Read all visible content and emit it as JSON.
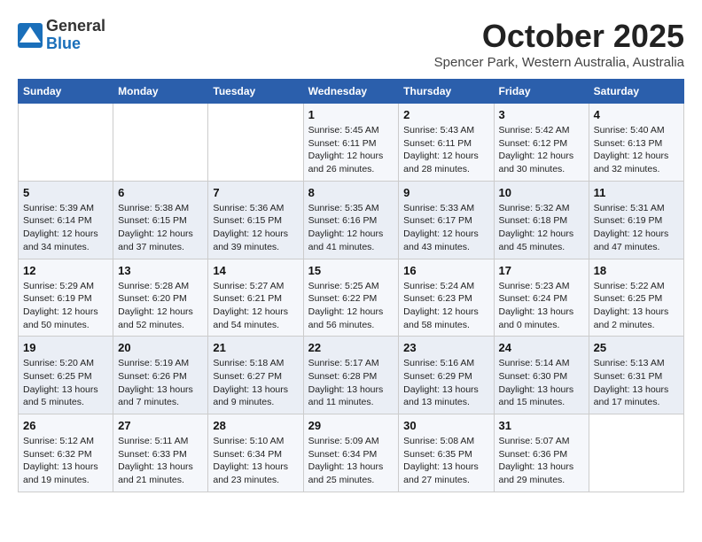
{
  "header": {
    "logo_general": "General",
    "logo_blue": "Blue",
    "month": "October 2025",
    "location": "Spencer Park, Western Australia, Australia"
  },
  "days_of_week": [
    "Sunday",
    "Monday",
    "Tuesday",
    "Wednesday",
    "Thursday",
    "Friday",
    "Saturday"
  ],
  "weeks": [
    [
      {
        "day": "",
        "detail": ""
      },
      {
        "day": "",
        "detail": ""
      },
      {
        "day": "",
        "detail": ""
      },
      {
        "day": "1",
        "detail": "Sunrise: 5:45 AM\nSunset: 6:11 PM\nDaylight: 12 hours\nand 26 minutes."
      },
      {
        "day": "2",
        "detail": "Sunrise: 5:43 AM\nSunset: 6:11 PM\nDaylight: 12 hours\nand 28 minutes."
      },
      {
        "day": "3",
        "detail": "Sunrise: 5:42 AM\nSunset: 6:12 PM\nDaylight: 12 hours\nand 30 minutes."
      },
      {
        "day": "4",
        "detail": "Sunrise: 5:40 AM\nSunset: 6:13 PM\nDaylight: 12 hours\nand 32 minutes."
      }
    ],
    [
      {
        "day": "5",
        "detail": "Sunrise: 5:39 AM\nSunset: 6:14 PM\nDaylight: 12 hours\nand 34 minutes."
      },
      {
        "day": "6",
        "detail": "Sunrise: 5:38 AM\nSunset: 6:15 PM\nDaylight: 12 hours\nand 37 minutes."
      },
      {
        "day": "7",
        "detail": "Sunrise: 5:36 AM\nSunset: 6:15 PM\nDaylight: 12 hours\nand 39 minutes."
      },
      {
        "day": "8",
        "detail": "Sunrise: 5:35 AM\nSunset: 6:16 PM\nDaylight: 12 hours\nand 41 minutes."
      },
      {
        "day": "9",
        "detail": "Sunrise: 5:33 AM\nSunset: 6:17 PM\nDaylight: 12 hours\nand 43 minutes."
      },
      {
        "day": "10",
        "detail": "Sunrise: 5:32 AM\nSunset: 6:18 PM\nDaylight: 12 hours\nand 45 minutes."
      },
      {
        "day": "11",
        "detail": "Sunrise: 5:31 AM\nSunset: 6:19 PM\nDaylight: 12 hours\nand 47 minutes."
      }
    ],
    [
      {
        "day": "12",
        "detail": "Sunrise: 5:29 AM\nSunset: 6:19 PM\nDaylight: 12 hours\nand 50 minutes."
      },
      {
        "day": "13",
        "detail": "Sunrise: 5:28 AM\nSunset: 6:20 PM\nDaylight: 12 hours\nand 52 minutes."
      },
      {
        "day": "14",
        "detail": "Sunrise: 5:27 AM\nSunset: 6:21 PM\nDaylight: 12 hours\nand 54 minutes."
      },
      {
        "day": "15",
        "detail": "Sunrise: 5:25 AM\nSunset: 6:22 PM\nDaylight: 12 hours\nand 56 minutes."
      },
      {
        "day": "16",
        "detail": "Sunrise: 5:24 AM\nSunset: 6:23 PM\nDaylight: 12 hours\nand 58 minutes."
      },
      {
        "day": "17",
        "detail": "Sunrise: 5:23 AM\nSunset: 6:24 PM\nDaylight: 13 hours\nand 0 minutes."
      },
      {
        "day": "18",
        "detail": "Sunrise: 5:22 AM\nSunset: 6:25 PM\nDaylight: 13 hours\nand 2 minutes."
      }
    ],
    [
      {
        "day": "19",
        "detail": "Sunrise: 5:20 AM\nSunset: 6:25 PM\nDaylight: 13 hours\nand 5 minutes."
      },
      {
        "day": "20",
        "detail": "Sunrise: 5:19 AM\nSunset: 6:26 PM\nDaylight: 13 hours\nand 7 minutes."
      },
      {
        "day": "21",
        "detail": "Sunrise: 5:18 AM\nSunset: 6:27 PM\nDaylight: 13 hours\nand 9 minutes."
      },
      {
        "day": "22",
        "detail": "Sunrise: 5:17 AM\nSunset: 6:28 PM\nDaylight: 13 hours\nand 11 minutes."
      },
      {
        "day": "23",
        "detail": "Sunrise: 5:16 AM\nSunset: 6:29 PM\nDaylight: 13 hours\nand 13 minutes."
      },
      {
        "day": "24",
        "detail": "Sunrise: 5:14 AM\nSunset: 6:30 PM\nDaylight: 13 hours\nand 15 minutes."
      },
      {
        "day": "25",
        "detail": "Sunrise: 5:13 AM\nSunset: 6:31 PM\nDaylight: 13 hours\nand 17 minutes."
      }
    ],
    [
      {
        "day": "26",
        "detail": "Sunrise: 5:12 AM\nSunset: 6:32 PM\nDaylight: 13 hours\nand 19 minutes."
      },
      {
        "day": "27",
        "detail": "Sunrise: 5:11 AM\nSunset: 6:33 PM\nDaylight: 13 hours\nand 21 minutes."
      },
      {
        "day": "28",
        "detail": "Sunrise: 5:10 AM\nSunset: 6:34 PM\nDaylight: 13 hours\nand 23 minutes."
      },
      {
        "day": "29",
        "detail": "Sunrise: 5:09 AM\nSunset: 6:34 PM\nDaylight: 13 hours\nand 25 minutes."
      },
      {
        "day": "30",
        "detail": "Sunrise: 5:08 AM\nSunset: 6:35 PM\nDaylight: 13 hours\nand 27 minutes."
      },
      {
        "day": "31",
        "detail": "Sunrise: 5:07 AM\nSunset: 6:36 PM\nDaylight: 13 hours\nand 29 minutes."
      },
      {
        "day": "",
        "detail": ""
      }
    ]
  ]
}
